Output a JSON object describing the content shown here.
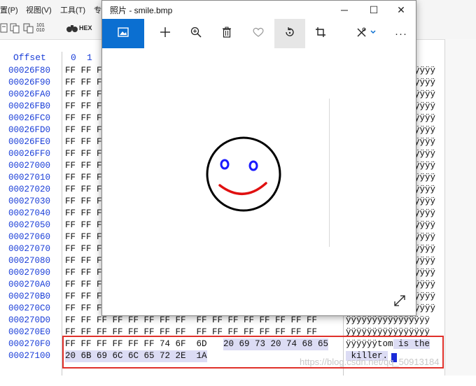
{
  "hex_app": {
    "menu": [
      "置(P)",
      "视图(V)",
      "工具(T)",
      "专"
    ],
    "toolbar_hex_label": "HEX",
    "toolbar_num_label": "101\n010",
    "header": {
      "offset": "Offset",
      "col0": "0",
      "col1": "1"
    },
    "offsets": [
      "00026F80",
      "00026F90",
      "00026FA0",
      "00026FB0",
      "00026FC0",
      "00026FD0",
      "00026FE0",
      "00026FF0",
      "00027000",
      "00027010",
      "00027020",
      "00027030",
      "00027040",
      "00027050",
      "00027060",
      "00027070",
      "00027080",
      "00027090",
      "000270A0",
      "000270B0",
      "000270C0",
      "000270D0",
      "000270E0",
      "000270F0",
      "00027100"
    ],
    "row_prefix": "FF FF F",
    "row_ascii_tail": "ÿÿÿÿ",
    "row_70D0_hex": "FF FF FF FF FF FF FF FF  FF FF FF FF FF FF FF FF",
    "row_70E0_hex": "FF FF FF FF FF FF FF FF  FF FF FF FF FF FF FF FF",
    "row_70F0_hex_plain": "FF FF FF FF FF FF 74 6F  6D",
    "row_70F0_hex_hl": "20 69 73 20 74 68 65",
    "row_7100_hex_hl": "20 6B 69 6C 6C 65 72 2E  1A",
    "ascii_70D0": "ÿÿÿÿÿÿÿÿÿÿÿÿÿÿÿÿ",
    "ascii_70E0": "ÿÿÿÿÿÿÿÿÿÿÿÿÿÿÿÿ",
    "ascii_70F0_plain": "ÿÿÿÿÿÿtom",
    "ascii_70F0_hl": " is the",
    "ascii_7100_hl": " killer.",
    "watermark": "https://blog.csdn.net/qq_50913184"
  },
  "photos": {
    "title": "照片 - smile.bmp",
    "window_buttons": {
      "minimize": "─",
      "maximize": "☐",
      "close": "✕"
    },
    "commands": [
      "view-image-icon",
      "add-icon",
      "zoom-in-icon",
      "delete-icon",
      "favorite-icon",
      "rotate-icon",
      "crop-icon",
      "edit-draw-icon",
      "more-icon"
    ],
    "more_label": "···",
    "accent_color": "#0b6fd1",
    "image": {
      "face_outline": "#000000",
      "eyes": "#1a1aff",
      "mouth": "#e01010"
    }
  }
}
